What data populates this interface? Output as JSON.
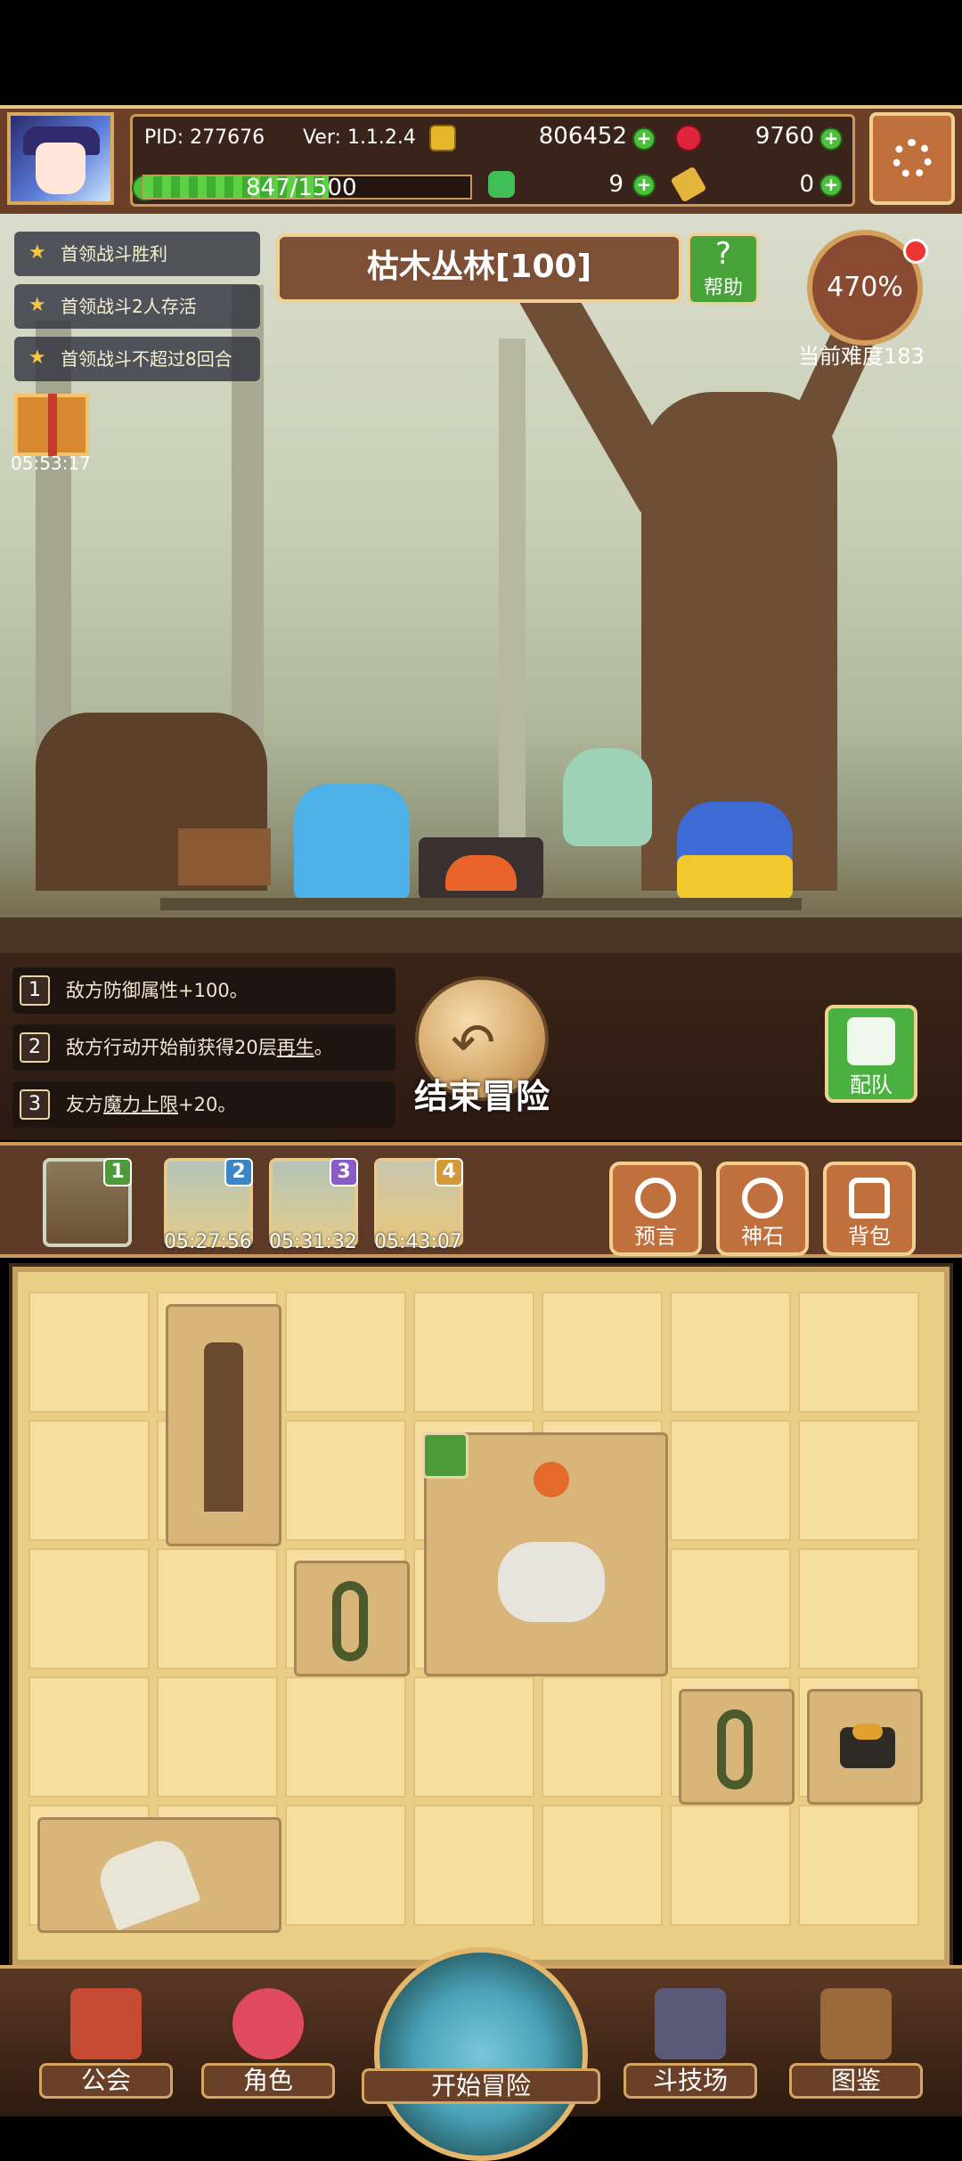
{
  "header": {
    "pid": "PID: 277676",
    "version": "Ver: 1.1.2.4",
    "gold": "806452",
    "gems": "9760",
    "xp_text": "847/1500",
    "xp_fraction": 0.565,
    "clover": "9",
    "keys": "0"
  },
  "objectives": [
    "首领战斗胜利",
    "首领战斗2人存活",
    "首领战斗不超过8回合"
  ],
  "stage": {
    "title": "枯木丛林[100]",
    "help_label": "帮助",
    "difficulty_percent": "470%",
    "difficulty_label": "当前难度183"
  },
  "gift_timer": "05:53:17",
  "modifiers": [
    {
      "num": "1",
      "pre": "敌方防御属性+100。",
      "link": "",
      "post": ""
    },
    {
      "num": "2",
      "pre": "敌方行动开始前获得20层",
      "link": "再生",
      "post": "。"
    },
    {
      "num": "3",
      "pre": "友方",
      "link": "魔力上限",
      "post": "+20。"
    }
  ],
  "end_adventure_label": "结束冒险",
  "team_label": "配队",
  "slots": [
    {
      "num": "1",
      "timer": "",
      "badge_color": "#4c9a3a"
    },
    {
      "num": "2",
      "timer": "05:27:56",
      "badge_color": "#3b86c7"
    },
    {
      "num": "3",
      "timer": "05:31:32",
      "badge_color": "#8a5ac8"
    },
    {
      "num": "4",
      "timer": "05:43:07",
      "badge_color": "#d49a3a"
    }
  ],
  "right_buttons": [
    "预言",
    "神石",
    "背包"
  ],
  "nav": {
    "guild": "公会",
    "character": "角色",
    "start": "开始冒险",
    "arena": "斗技场",
    "codex": "图鉴"
  },
  "colors": {
    "accent_gold": "#f0cf91",
    "panel_brown": "#6b3e28",
    "green": "#4bc03a"
  }
}
